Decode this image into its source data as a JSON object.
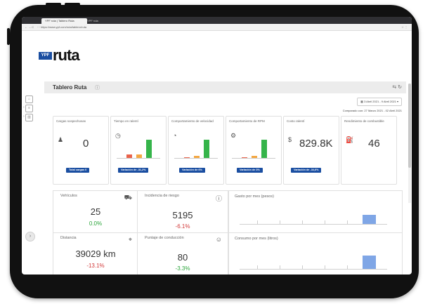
{
  "browser": {
    "tabs": [
      "YPF ruta | Tablero Ruta",
      "YPF ruta"
    ],
    "nav": "← → C",
    "url": "⋯ https://www.ypf.com/ruta/tablero/ruta",
    "menu": "☆ ⋮"
  },
  "logo": {
    "badge": "YPF",
    "word": "ruta"
  },
  "sidebar": {
    "expand_icon": "›"
  },
  "panel": {
    "title": "Tablero Ruta",
    "info_icon": "ⓘ",
    "actions": "⇆ ↻",
    "date_range": "▦ 3 Abril 2021 - 9 Abril 2021 ▾",
    "compare_text": "Comparado con: 27 Marzo 2021 - 02 Abril 2021"
  },
  "cards": [
    {
      "title": "Cargas sospechosas",
      "value": "0",
      "button": "Total cargas 0",
      "icon": "person-icon"
    },
    {
      "title": "Tiempo en ralentí",
      "value": "",
      "button": "Variación de -31,2%",
      "icon": "clock-icon"
    },
    {
      "title": "Comportamiento de velocidad",
      "value": "",
      "button": "Variación de 6%",
      "icon": "speed-icon"
    },
    {
      "title": "Comportamiento de RPM",
      "value": "",
      "button": "Variación de 3%",
      "icon": "rpm-icon"
    },
    {
      "title": "Costo ralentí",
      "value": "829.8K",
      "button": "Variación de -34,6%",
      "icon": "money-icon"
    },
    {
      "title": "Rendimiento de combustible",
      "value": "46",
      "button": "",
      "icon": "fuel-icon"
    }
  ],
  "mini_charts": {
    "tiempo": {
      "values": [
        0.2,
        0.2,
        1.0
      ],
      "colors": [
        "#e9624a",
        "#f4a742",
        "#35b44a"
      ]
    },
    "velocidad": {
      "values": [
        0.05,
        0.1,
        1.0
      ],
      "colors": [
        "#e9624a",
        "#f4a742",
        "#35b44a"
      ]
    },
    "rpm": {
      "values": [
        0.05,
        0.1,
        1.0
      ],
      "colors": [
        "#e9624a",
        "#f4a742",
        "#35b44a"
      ]
    }
  },
  "stats": {
    "vehiculos": {
      "title": "Vehículos",
      "value": "25",
      "pct": "0.0%",
      "pct_color": "#2aa53a"
    },
    "incidencia": {
      "title": "Incidencia de riesgo",
      "value": "5195",
      "pct": "-6.1%",
      "pct_color": "#d23a3a"
    },
    "distancia": {
      "title": "Distancia",
      "value": "39029 km",
      "pct": "-13.1%",
      "pct_color": "#d23a3a"
    },
    "puntaje": {
      "title": "Puntaje de conducción",
      "value": "80",
      "pct": "-3.3%",
      "pct_color": "#2aa53a"
    }
  },
  "charts": {
    "gasto": {
      "title": "Gasto por mes (pesos)",
      "bar_label": ""
    },
    "consumo": {
      "title": "Consumo por mes (litros)",
      "bar_label": ""
    }
  },
  "colors": {
    "accent": "#1a4ea1",
    "green": "#35b44a",
    "orange": "#f4a742",
    "red": "#e9624a"
  }
}
